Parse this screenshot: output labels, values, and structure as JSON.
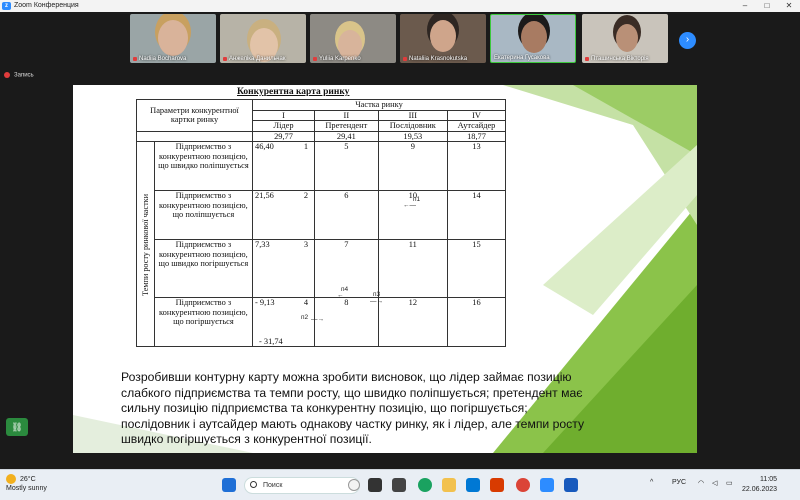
{
  "window": {
    "title": "Zoom Конференция"
  },
  "participants": [
    {
      "name": "Nadiia Bocharova",
      "bg": "#9aa5a6",
      "skin": "#d9b39a",
      "hair": "#c8a060"
    },
    {
      "name": "Анжеліка Данильчак",
      "bg": "#b7b3a7",
      "skin": "#e2c3a8",
      "hair": "#c9b080"
    },
    {
      "name": "Yuliia Karpenko",
      "bg": "#8d8a84",
      "skin": "#d8b49b",
      "hair": "#d9c48a"
    },
    {
      "name": "Nataliia Krasnokutska",
      "bg": "#6b5a4d",
      "skin": "#cfa58b",
      "hair": "#2e2622"
    },
    {
      "name": "Екатерина Гусакова",
      "bg": "#a9b8c4",
      "skin": "#a87b62",
      "hair": "#1c1a1a"
    },
    {
      "name": "Пташинська Вікторія",
      "bg": "#c9c4bb",
      "skin": "#b99077",
      "hair": "#3a2c25"
    }
  ],
  "recording": {
    "label": "Запись"
  },
  "slide": {
    "table_title": "Конкурентна карта ринку",
    "header": {
      "params": "Параметри конкурентної картки ринку",
      "share": "Частка ринку",
      "roman": [
        "I",
        "II",
        "III",
        "IV"
      ],
      "roles": [
        "Лідер",
        "Претендент",
        "Послідовник",
        "Аутсайдер"
      ],
      "values": [
        "29,77",
        "29,41",
        "19,53",
        "18,77"
      ]
    },
    "vertical_label": "Темпи росту ринкової частки",
    "rows": [
      {
        "label": "Підприємство з конкурентною позицією, що швидко поліпшується",
        "val": "46,40",
        "cells": [
          "1",
          "5",
          "9",
          "13"
        ],
        "extra": ""
      },
      {
        "label": "Підприємство з конкурентною позицією, що поліпшується",
        "val": "21,56",
        "cells": [
          "2",
          "6",
          "10",
          "14"
        ],
        "extra": ""
      },
      {
        "label": "Підприємство з конкурентною позицією, що швидко погіршується",
        "val": "7,33",
        "cells": [
          "3",
          "7",
          "11",
          "15"
        ],
        "extra": ""
      },
      {
        "label": "Підприємство з конкурентною позицією, що погіршується",
        "val": "- 9,13",
        "cells": [
          "4",
          "8",
          "12",
          "16"
        ],
        "extra": "- 31,74"
      }
    ],
    "arrows": [
      "п1",
      "п4",
      "п3",
      "п2"
    ],
    "caption": "Розробивши контурну карту можна зробити висновок, що лідер займає позицію слабкого підприємства та темпи росту, що швидко поліпшується; претендент має сильну позицію підприємства та конкурентну позицію, що погіршується; послідовник і аутсайдер мають однакову  частку ринку, як і лідер, але темпи росту швидко погіршується з конкурентної позиції."
  },
  "taskbar": {
    "temp": "26°C",
    "weather": "Mostly sunny",
    "search_placeholder": "Поиск",
    "lang": "РУС",
    "time": "11:05",
    "date": "22.06.2023"
  }
}
